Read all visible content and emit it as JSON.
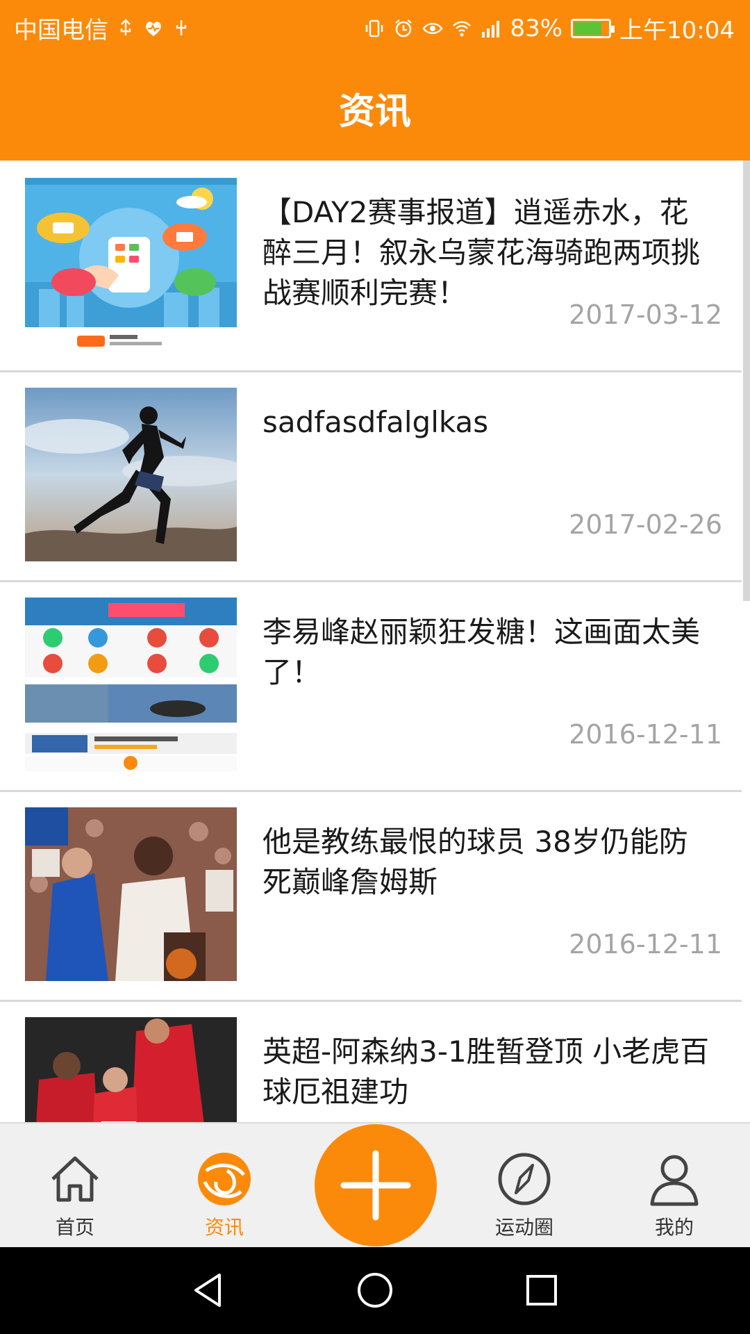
{
  "status_bar": {
    "carrier": "中国电信",
    "battery_percent": "83%",
    "time": "上午10:04",
    "battery_level": 0.83
  },
  "header": {
    "title": "资讯"
  },
  "news": [
    {
      "title": "【DAY2赛事报道】逍遥赤水，花醉三月！叙永乌蒙花海骑跑两项挑战赛顺利完赛！",
      "date": "2017-03-12"
    },
    {
      "title": "sadfasdfalglkas",
      "date": "2017-02-26"
    },
    {
      "title": "李易峰赵丽颖狂发糖！这画面太美了！",
      "date": "2016-12-11"
    },
    {
      "title": "他是教练最恨的球员 38岁仍能防死巅峰詹姆斯",
      "date": "2016-12-11"
    },
    {
      "title": "英超-阿森纳3-1胜暂登顶 小老虎百球厄祖建功",
      "date": ""
    }
  ],
  "tabs": {
    "home": "首页",
    "news": "资讯",
    "moments": "运动圈",
    "mine": "我的"
  },
  "colors": {
    "accent": "#fb8a0b",
    "tab_bg": "#f0f0f0",
    "date_text": "#a4a4a4"
  }
}
